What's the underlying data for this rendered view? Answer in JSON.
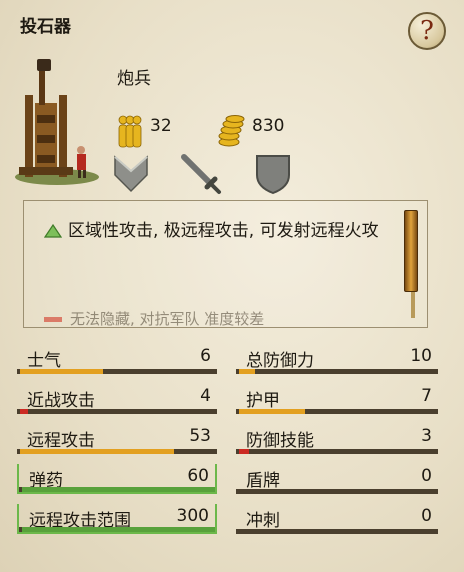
{
  "header": {
    "title": "投石器",
    "help_icon": "question-mark-icon"
  },
  "unit": {
    "name": "炮兵",
    "men_count": "32",
    "cost": "830",
    "icons": [
      "soldiers-icon",
      "gold-coins-icon",
      "chevron-down-icon",
      "sword-icon",
      "shield-icon"
    ]
  },
  "description": {
    "positive": "区域性攻击, 极远程攻击, 可发射远程火攻",
    "negative": "无法隐藏, 对抗军队 准度较差"
  },
  "stats_left": [
    {
      "label": "士气",
      "value": "6",
      "level": 0.42,
      "bar": "orange"
    },
    {
      "label": "近战攻击",
      "value": "4",
      "level": 0.04,
      "bar": "red"
    },
    {
      "label": "远程攻击",
      "value": "53",
      "level": 0.78,
      "bar": "orange"
    },
    {
      "label": "弹药",
      "value": "60",
      "level": 1.0,
      "bar": "green"
    },
    {
      "label": "远程攻击范围",
      "value": "300",
      "level": 1.0,
      "bar": "green"
    }
  ],
  "stats_right": [
    {
      "label": "总防御力",
      "value": "10",
      "level": 0.08,
      "bar": "orange"
    },
    {
      "label": "护甲",
      "value": "7",
      "level": 0.33,
      "bar": "orange"
    },
    {
      "label": "防御技能",
      "value": "3",
      "level": 0.05,
      "bar": "red"
    },
    {
      "label": "盾牌",
      "value": "0",
      "level": 0,
      "bar": "orange"
    },
    {
      "label": "冲刺",
      "value": "0",
      "level": 0,
      "bar": "orange"
    }
  ],
  "colors": {
    "bar_orange": "#e3a020",
    "bar_red": "#cc2a22",
    "bar_green": "#58a13b",
    "track": "#4a3f2e"
  }
}
